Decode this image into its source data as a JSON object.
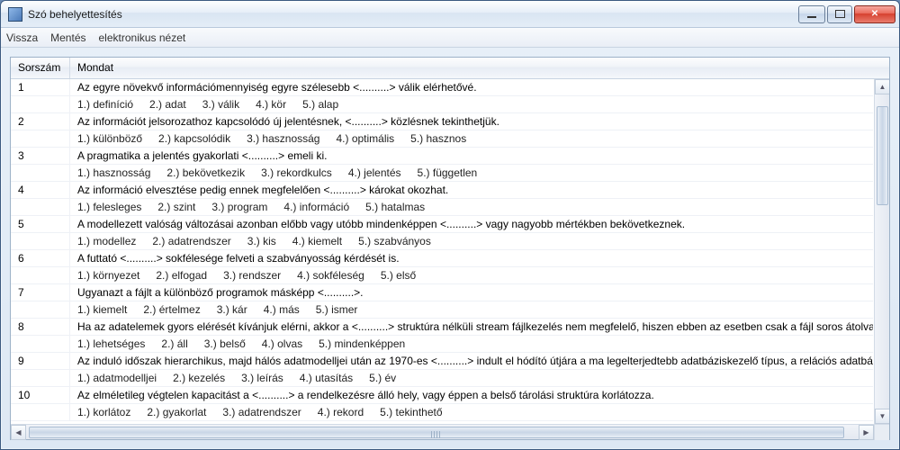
{
  "window": {
    "title": "Szó behelyettesítés"
  },
  "menu": {
    "back": "Vissza",
    "save": "Mentés",
    "eview": "elektronikus nézet"
  },
  "columns": {
    "num": "Sorszám",
    "sentence": "Mondat"
  },
  "rows": [
    {
      "n": "1",
      "sentence": "Az egyre növekvő információmennyiség egyre szélesebb <..........> válik elérhetővé.",
      "opts": [
        "1.) definíció",
        "2.) adat",
        "3.) válik",
        "4.) kör",
        "5.) alap"
      ]
    },
    {
      "n": "2",
      "sentence": "Az információt jelsorozathoz kapcsolódó új jelentésnek, <..........> közlésnek tekinthetjük.",
      "opts": [
        "1.) különböző",
        "2.) kapcsolódik",
        "3.) hasznosság",
        "4.) optimális",
        "5.) hasznos"
      ]
    },
    {
      "n": "3",
      "sentence": "A pragmatika a jelentés gyakorlati <..........> emeli ki.",
      "opts": [
        "1.) hasznosság",
        "2.) bekövetkezik",
        "3.) rekordkulcs",
        "4.) jelentés",
        "5.) független"
      ]
    },
    {
      "n": "4",
      "sentence": "Az információ elvesztése pedig ennek megfelelően <..........> károkat okozhat.",
      "opts": [
        "1.) felesleges",
        "2.) szint",
        "3.) program",
        "4.) információ",
        "5.) hatalmas"
      ]
    },
    {
      "n": "5",
      "sentence": "A modellezett valóság változásai azonban előbb vagy utóbb mindenképpen <..........> vagy nagyobb mértékben bekövetkeznek.",
      "opts": [
        "1.) modellez",
        "2.) adatrendszer",
        "3.) kis",
        "4.) kiemelt",
        "5.) szabványos"
      ]
    },
    {
      "n": "6",
      "sentence": "A futtató <..........> sokfélesége felveti a szabványosság kérdését is.",
      "opts": [
        "1.) környezet",
        "2.) elfogad",
        "3.) rendszer",
        "4.) sokféleség",
        "5.) első"
      ]
    },
    {
      "n": "7",
      "sentence": "Ugyanazt a fájlt a különböző programok másképp <..........>.",
      "opts": [
        "1.) kiemelt",
        "2.) értelmez",
        "3.) kár",
        "4.) más",
        "5.) ismer"
      ]
    },
    {
      "n": "8",
      "sentence": "Ha az adatelemek gyors elérését kívánjuk elérni, akkor a <..........> struktúra nélküli stream fájlkezelés nem megfelelő, hiszen ebben az esetben csak a fájl soros átolvasásá",
      "opts": [
        "1.) lehetséges",
        "2.) áll",
        "3.) belső",
        "4.) olvas",
        "5.) mindenképpen"
      ]
    },
    {
      "n": "9",
      "sentence": "Az induló időszak hierarchikus, majd hálós adatmodelljei után az 1970-es <..........> indult el hódító útjára a ma legelterjedtebb adatbáziskezelő típus, a relációs adatbázis",
      "opts": [
        "1.) adatmodelljei",
        "2.) kezelés",
        "3.) leírás",
        "4.) utasítás",
        "5.) év"
      ]
    },
    {
      "n": "10",
      "sentence": "Az elméletileg végtelen kapacitást a <..........> a rendelkezésre álló hely, vagy éppen a belső tárolási struktúra korlátozza.",
      "opts": [
        "1.) korlátoz",
        "2.) gyakorlat",
        "3.) adatrendszer",
        "4.) rekord",
        "5.) tekinthető"
      ]
    }
  ]
}
